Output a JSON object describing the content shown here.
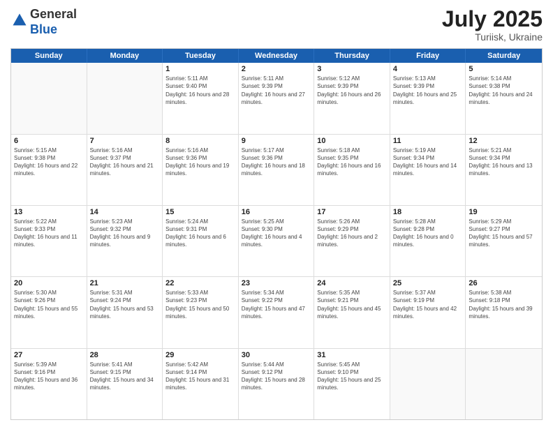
{
  "header": {
    "logo": {
      "line1": "General",
      "line2": "Blue"
    },
    "title": "July 2025",
    "location": "Turiisk, Ukraine"
  },
  "weekdays": [
    "Sunday",
    "Monday",
    "Tuesday",
    "Wednesday",
    "Thursday",
    "Friday",
    "Saturday"
  ],
  "weeks": [
    [
      {
        "day": "",
        "empty": true
      },
      {
        "day": "",
        "empty": true
      },
      {
        "day": "1",
        "sunrise": "Sunrise: 5:11 AM",
        "sunset": "Sunset: 9:40 PM",
        "daylight": "Daylight: 16 hours and 28 minutes."
      },
      {
        "day": "2",
        "sunrise": "Sunrise: 5:11 AM",
        "sunset": "Sunset: 9:39 PM",
        "daylight": "Daylight: 16 hours and 27 minutes."
      },
      {
        "day": "3",
        "sunrise": "Sunrise: 5:12 AM",
        "sunset": "Sunset: 9:39 PM",
        "daylight": "Daylight: 16 hours and 26 minutes."
      },
      {
        "day": "4",
        "sunrise": "Sunrise: 5:13 AM",
        "sunset": "Sunset: 9:39 PM",
        "daylight": "Daylight: 16 hours and 25 minutes."
      },
      {
        "day": "5",
        "sunrise": "Sunrise: 5:14 AM",
        "sunset": "Sunset: 9:38 PM",
        "daylight": "Daylight: 16 hours and 24 minutes."
      }
    ],
    [
      {
        "day": "6",
        "sunrise": "Sunrise: 5:15 AM",
        "sunset": "Sunset: 9:38 PM",
        "daylight": "Daylight: 16 hours and 22 minutes."
      },
      {
        "day": "7",
        "sunrise": "Sunrise: 5:16 AM",
        "sunset": "Sunset: 9:37 PM",
        "daylight": "Daylight: 16 hours and 21 minutes."
      },
      {
        "day": "8",
        "sunrise": "Sunrise: 5:16 AM",
        "sunset": "Sunset: 9:36 PM",
        "daylight": "Daylight: 16 hours and 19 minutes."
      },
      {
        "day": "9",
        "sunrise": "Sunrise: 5:17 AM",
        "sunset": "Sunset: 9:36 PM",
        "daylight": "Daylight: 16 hours and 18 minutes."
      },
      {
        "day": "10",
        "sunrise": "Sunrise: 5:18 AM",
        "sunset": "Sunset: 9:35 PM",
        "daylight": "Daylight: 16 hours and 16 minutes."
      },
      {
        "day": "11",
        "sunrise": "Sunrise: 5:19 AM",
        "sunset": "Sunset: 9:34 PM",
        "daylight": "Daylight: 16 hours and 14 minutes."
      },
      {
        "day": "12",
        "sunrise": "Sunrise: 5:21 AM",
        "sunset": "Sunset: 9:34 PM",
        "daylight": "Daylight: 16 hours and 13 minutes."
      }
    ],
    [
      {
        "day": "13",
        "sunrise": "Sunrise: 5:22 AM",
        "sunset": "Sunset: 9:33 PM",
        "daylight": "Daylight: 16 hours and 11 minutes."
      },
      {
        "day": "14",
        "sunrise": "Sunrise: 5:23 AM",
        "sunset": "Sunset: 9:32 PM",
        "daylight": "Daylight: 16 hours and 9 minutes."
      },
      {
        "day": "15",
        "sunrise": "Sunrise: 5:24 AM",
        "sunset": "Sunset: 9:31 PM",
        "daylight": "Daylight: 16 hours and 6 minutes."
      },
      {
        "day": "16",
        "sunrise": "Sunrise: 5:25 AM",
        "sunset": "Sunset: 9:30 PM",
        "daylight": "Daylight: 16 hours and 4 minutes."
      },
      {
        "day": "17",
        "sunrise": "Sunrise: 5:26 AM",
        "sunset": "Sunset: 9:29 PM",
        "daylight": "Daylight: 16 hours and 2 minutes."
      },
      {
        "day": "18",
        "sunrise": "Sunrise: 5:28 AM",
        "sunset": "Sunset: 9:28 PM",
        "daylight": "Daylight: 16 hours and 0 minutes."
      },
      {
        "day": "19",
        "sunrise": "Sunrise: 5:29 AM",
        "sunset": "Sunset: 9:27 PM",
        "daylight": "Daylight: 15 hours and 57 minutes."
      }
    ],
    [
      {
        "day": "20",
        "sunrise": "Sunrise: 5:30 AM",
        "sunset": "Sunset: 9:26 PM",
        "daylight": "Daylight: 15 hours and 55 minutes."
      },
      {
        "day": "21",
        "sunrise": "Sunrise: 5:31 AM",
        "sunset": "Sunset: 9:24 PM",
        "daylight": "Daylight: 15 hours and 53 minutes."
      },
      {
        "day": "22",
        "sunrise": "Sunrise: 5:33 AM",
        "sunset": "Sunset: 9:23 PM",
        "daylight": "Daylight: 15 hours and 50 minutes."
      },
      {
        "day": "23",
        "sunrise": "Sunrise: 5:34 AM",
        "sunset": "Sunset: 9:22 PM",
        "daylight": "Daylight: 15 hours and 47 minutes."
      },
      {
        "day": "24",
        "sunrise": "Sunrise: 5:35 AM",
        "sunset": "Sunset: 9:21 PM",
        "daylight": "Daylight: 15 hours and 45 minutes."
      },
      {
        "day": "25",
        "sunrise": "Sunrise: 5:37 AM",
        "sunset": "Sunset: 9:19 PM",
        "daylight": "Daylight: 15 hours and 42 minutes."
      },
      {
        "day": "26",
        "sunrise": "Sunrise: 5:38 AM",
        "sunset": "Sunset: 9:18 PM",
        "daylight": "Daylight: 15 hours and 39 minutes."
      }
    ],
    [
      {
        "day": "27",
        "sunrise": "Sunrise: 5:39 AM",
        "sunset": "Sunset: 9:16 PM",
        "daylight": "Daylight: 15 hours and 36 minutes."
      },
      {
        "day": "28",
        "sunrise": "Sunrise: 5:41 AM",
        "sunset": "Sunset: 9:15 PM",
        "daylight": "Daylight: 15 hours and 34 minutes."
      },
      {
        "day": "29",
        "sunrise": "Sunrise: 5:42 AM",
        "sunset": "Sunset: 9:14 PM",
        "daylight": "Daylight: 15 hours and 31 minutes."
      },
      {
        "day": "30",
        "sunrise": "Sunrise: 5:44 AM",
        "sunset": "Sunset: 9:12 PM",
        "daylight": "Daylight: 15 hours and 28 minutes."
      },
      {
        "day": "31",
        "sunrise": "Sunrise: 5:45 AM",
        "sunset": "Sunset: 9:10 PM",
        "daylight": "Daylight: 15 hours and 25 minutes."
      },
      {
        "day": "",
        "empty": true
      },
      {
        "day": "",
        "empty": true
      }
    ]
  ]
}
